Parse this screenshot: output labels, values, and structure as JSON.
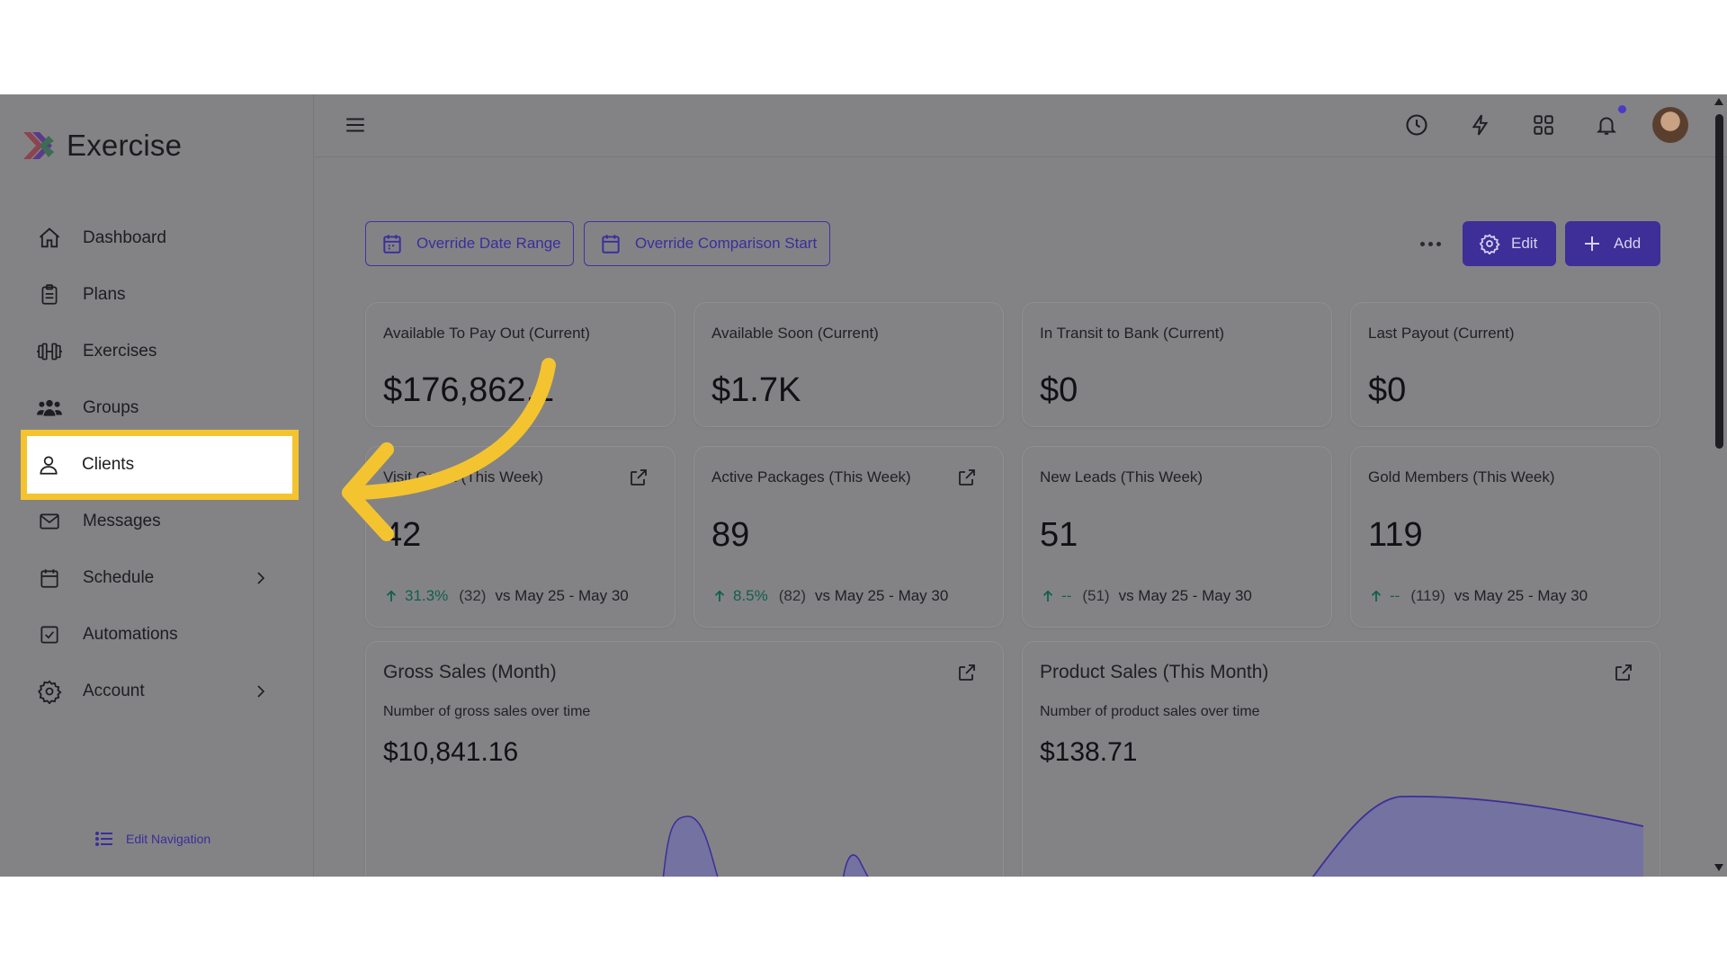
{
  "app": {
    "name": "Exercise",
    "brand_colors": [
      "#e23c4a",
      "#7c3aed",
      "#22c55e",
      "#3b82f6"
    ]
  },
  "sidebar": {
    "items": [
      {
        "label": "Dashboard",
        "icon": "home-icon"
      },
      {
        "label": "Plans",
        "icon": "clipboard-icon"
      },
      {
        "label": "Exercises",
        "icon": "dumbbell-icon"
      },
      {
        "label": "Groups",
        "icon": "users-icon"
      },
      {
        "label": "Clients",
        "icon": "user-icon",
        "active": true
      },
      {
        "label": "Messages",
        "icon": "mail-icon"
      },
      {
        "label": "Schedule",
        "icon": "calendar-icon",
        "expandable": true
      },
      {
        "label": "Automations",
        "icon": "check-square-icon"
      },
      {
        "label": "Account",
        "icon": "gear-icon",
        "expandable": true
      }
    ],
    "edit_navigation": "Edit Navigation"
  },
  "topbar": {
    "icons": [
      "menu-icon",
      "clock-icon",
      "bolt-icon",
      "grid-icon",
      "bell-icon"
    ],
    "has_notification": true
  },
  "toolbar": {
    "override_date_range": "Override Date Range",
    "override_comparison_start": "Override Comparison Start",
    "edit": "Edit",
    "add": "Add",
    "accent": "#3d2e98"
  },
  "kpi_row1": [
    {
      "label": "Available To Pay Out (Current)",
      "value": "$176,862.1"
    },
    {
      "label": "Available Soon (Current)",
      "value": "$1.7K"
    },
    {
      "label": "In Transit to Bank (Current)",
      "value": "$0"
    },
    {
      "label": "Last Payout (Current)",
      "value": "$0"
    }
  ],
  "kpi_row2": [
    {
      "label": "Visit Count (This Week)",
      "value": "42",
      "change": "31.3%",
      "prev": "(32)",
      "compare": "vs May 25 - May 30"
    },
    {
      "label": "Active Packages (This Week)",
      "value": "89",
      "change": "8.5%",
      "prev": "(82)",
      "compare": "vs May 25 - May 30"
    },
    {
      "label": "New Leads (This Week)",
      "value": "51",
      "change": "--",
      "prev": "(51)",
      "compare": "vs May 25 - May 30"
    },
    {
      "label": "Gold Members (This Week)",
      "value": "119",
      "change": "--",
      "prev": "(119)",
      "compare": "vs May 25 - May 30"
    }
  ],
  "charts": [
    {
      "title": "Gross Sales (Month)",
      "subtitle": "Number of gross sales over time",
      "value": "$10,841.16"
    },
    {
      "title": "Product Sales (This Month)",
      "subtitle": "Number of product sales over time",
      "value": "$138.71"
    }
  ],
  "highlight": {
    "color": "#f4c430",
    "target": "Clients"
  }
}
